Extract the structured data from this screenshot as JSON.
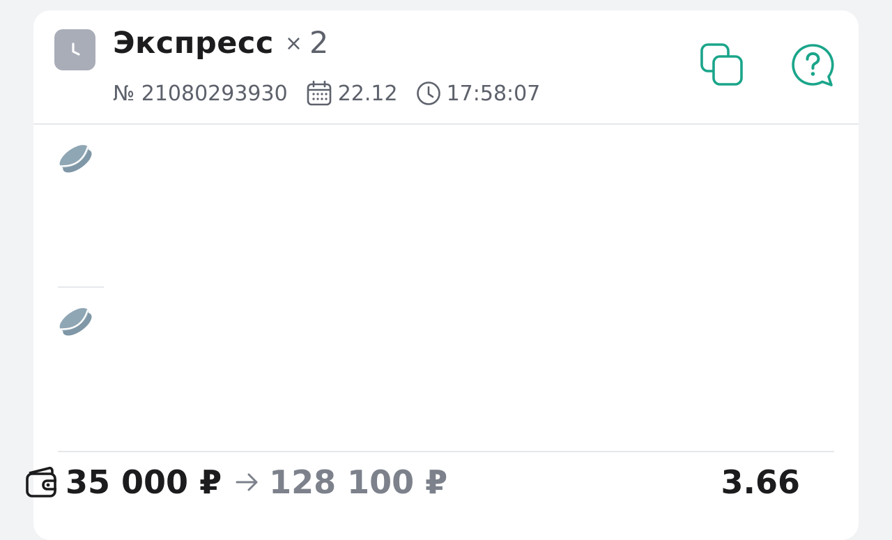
{
  "header": {
    "status_icon": "clock-icon",
    "title": "Экспресс",
    "multiplier_symbol": "×",
    "multiplier_count": "2",
    "bet_number": "№ 21080293930",
    "date_icon": "calendar-icon",
    "date": "22.12",
    "time_icon": "clock-outline-icon",
    "time": "17:58:07",
    "copy_icon": "copy-icon",
    "help_icon": "help-chat-icon"
  },
  "events": [
    {
      "icon": "hockey-puck-icon"
    },
    {
      "icon": "hockey-puck-icon"
    }
  ],
  "footer": {
    "wallet_icon": "wallet-icon",
    "stake": "35 000 ₽",
    "arrow_icon": "arrow-right-icon",
    "payout": "128 100 ₽",
    "odds": "3.66"
  },
  "colors": {
    "accent": "#1aa58a",
    "status_tile": "#a9adb8",
    "puck": "#7f97a6",
    "muted_text": "#5d616b",
    "background": "#f2f3f5"
  }
}
